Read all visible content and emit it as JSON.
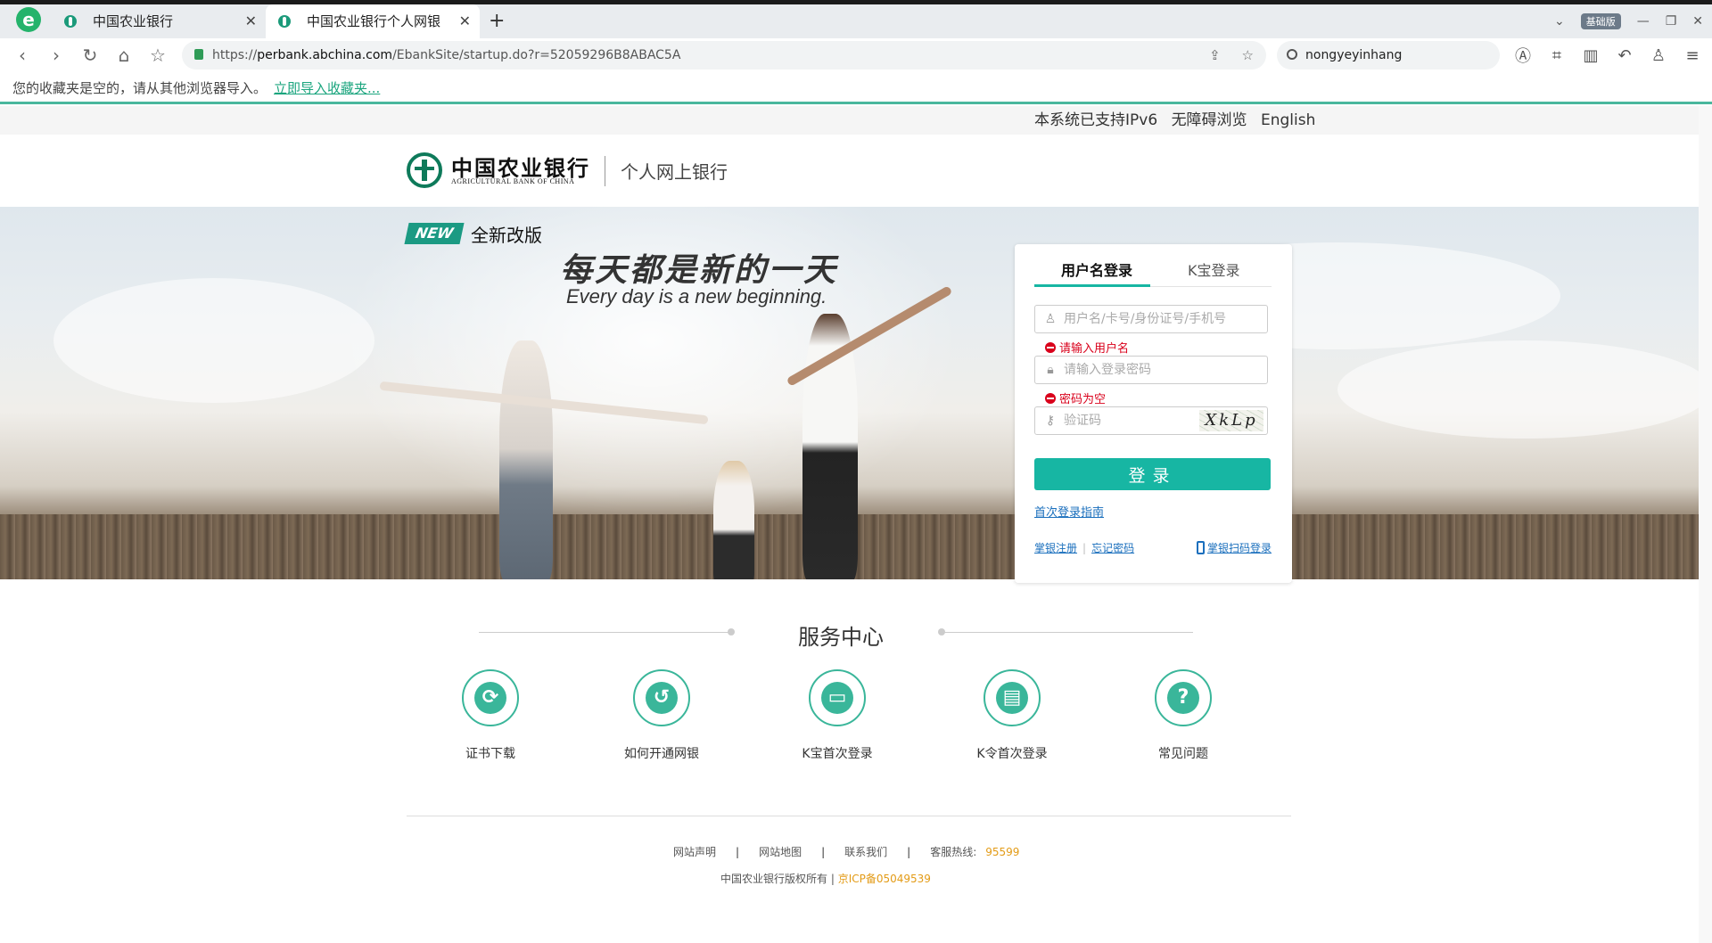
{
  "browser": {
    "logo": "e",
    "tabs": [
      {
        "label": "中国农业银行",
        "active": false
      },
      {
        "label": "中国农业银行个人网银",
        "active": true
      }
    ],
    "new_tab": "+",
    "badge": "基础版",
    "url_prefix": "https://",
    "url_domain": "perbank.abchina.com",
    "url_path": "/EbankSite/startup.do?r=52059296B8ABAC5A",
    "search_value": "nongyeyinhang",
    "bookmarks_text": "您的收藏夹是空的，请从其他浏览器导入。",
    "bookmarks_link": "立即导入收藏夹..."
  },
  "topbar": {
    "ipv6": "本系统已支持IPv6",
    "accessible": "无障碍浏览",
    "english": "English"
  },
  "header": {
    "logo_cn": "中国农业银行",
    "logo_en": "AGRICULTURAL BANK OF CHINA",
    "subtitle": "个人网上银行"
  },
  "banner": {
    "new_badge": "NEW",
    "new_text": "全新改版",
    "slogan_cn": "每天都是新的一天",
    "slogan_en": "Every day is a new beginning."
  },
  "login": {
    "tab_username": "用户名登录",
    "tab_kbao": "K宝登录",
    "username_placeholder": "用户名/卡号/身份证号/手机号",
    "username_error": "请输入用户名",
    "password_placeholder": "请输入登录密码",
    "password_error": "密码为空",
    "captcha_placeholder": "验证码",
    "captcha_text": "XkLp",
    "submit": "登录",
    "guide": "首次登录指南",
    "register": "掌银注册",
    "forgot": "忘记密码",
    "scan": "掌银扫码登录"
  },
  "services": {
    "title": "服务中心",
    "items": [
      {
        "label": "证书下载",
        "icon": "refresh-icon"
      },
      {
        "label": "如何开通网银",
        "icon": "open-icon"
      },
      {
        "label": "K宝首次登录",
        "icon": "card-icon"
      },
      {
        "label": "K令首次登录",
        "icon": "token-icon"
      },
      {
        "label": "常见问题",
        "icon": "question-icon"
      }
    ]
  },
  "footer": {
    "statement": "网站声明",
    "sitemap": "网站地图",
    "contact": "联系我们",
    "hotline_label": "客服热线:",
    "hotline": "95599",
    "copyright": "中国农业银行版权所有",
    "icp": "京ICP备05049539"
  },
  "colors": {
    "accent": "#17b6a3",
    "brand": "#0e7a5a",
    "error": "#d9001b",
    "link": "#1a6fbd",
    "hotline": "#e39b16"
  }
}
